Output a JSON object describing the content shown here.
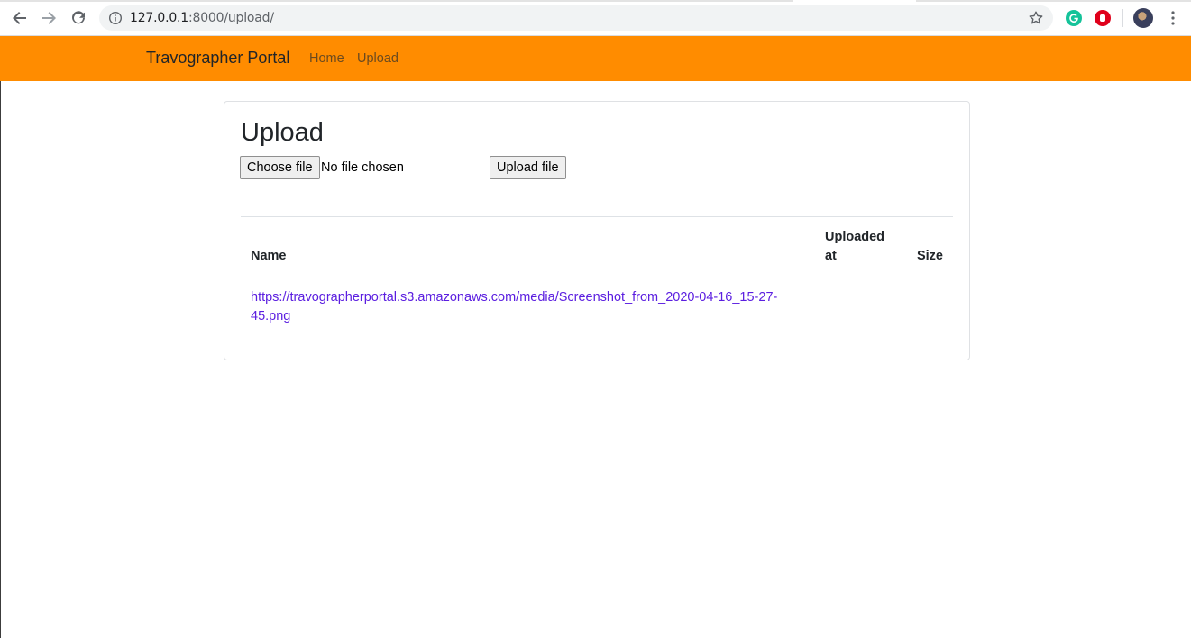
{
  "browser": {
    "url_host": "127.0.0.1",
    "url_path": ":8000/upload/",
    "icons": {
      "back": "back-arrow-icon",
      "forward": "forward-arrow-icon",
      "reload": "reload-icon",
      "info": "info-icon",
      "star": "star-icon",
      "grammarly": "grammarly-icon",
      "adblock": "adblock-icon",
      "menu": "kebab-menu-icon"
    }
  },
  "navbar": {
    "brand": "Travographer Portal",
    "links": [
      {
        "label": "Home"
      },
      {
        "label": "Upload"
      }
    ],
    "bg_color": "#ff8c00"
  },
  "upload": {
    "title": "Upload",
    "choose_label": "Choose file",
    "file_status": "No file chosen",
    "submit_label": "Upload file"
  },
  "table": {
    "headers": {
      "name": "Name",
      "uploaded_line1": "Uploaded",
      "uploaded_line2": "at",
      "size": "Size"
    },
    "rows": [
      {
        "name_line1": "https://travographerportal.s3.amazonaws.com/media/Screenshot_from_2020-04-16_15-27-",
        "name_line2": "45.png",
        "uploaded_at": "",
        "size": ""
      }
    ],
    "link_color": "#5b1ee0"
  }
}
